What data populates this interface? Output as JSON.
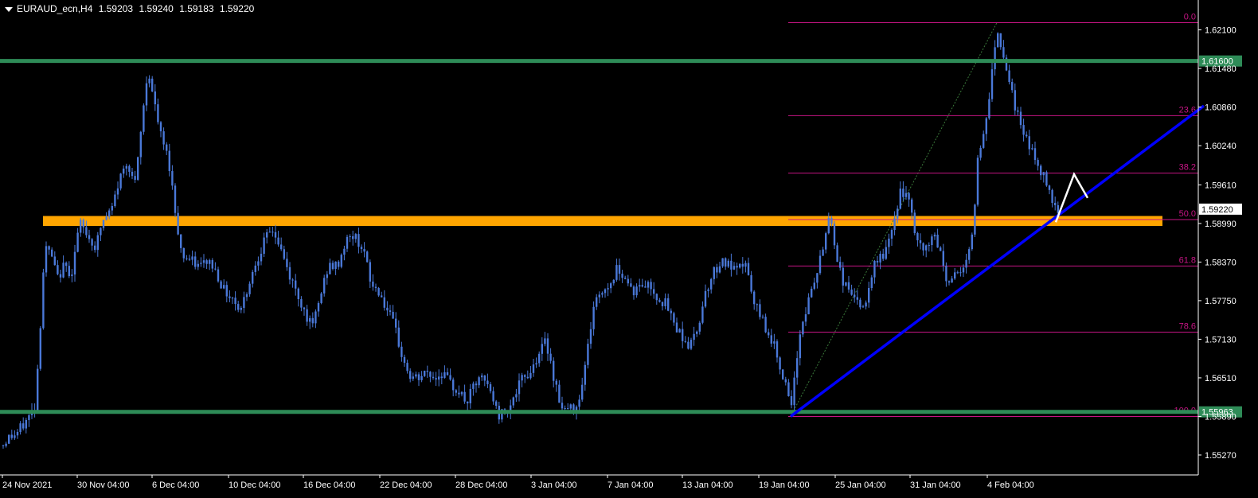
{
  "header": {
    "symbol": "EURAUD_ecn,H4",
    "open": "1.59203",
    "high": "1.59240",
    "low": "1.59183",
    "close": "1.59220"
  },
  "colors": {
    "background": "#000000",
    "candle": "#4a78d8",
    "support_line": "#2e8b57",
    "zone": "#ffa500",
    "trendline": "#0000ff",
    "fibo": "#c71585",
    "projection": "#ffffff",
    "axis_text": "#ffffff"
  },
  "chart_data": {
    "type": "candlestick",
    "symbol": "EURAUD_ecn",
    "timeframe": "H4",
    "ylim": [
      1.5495,
      1.6258
    ],
    "y_ticks": [
      "1.62100",
      "1.61480",
      "1.60860",
      "1.60240",
      "1.59610",
      "1.58990",
      "1.58370",
      "1.57750",
      "1.57130",
      "1.56510",
      "1.55890",
      "1.55270"
    ],
    "x_ticks": [
      "24 Nov 2021",
      "30 Nov 04:00",
      "6 Dec 04:00",
      "10 Dec 04:00",
      "16 Dec 04:00",
      "22 Dec 04:00",
      "28 Dec 04:00",
      "3 Jan 04:00",
      "7 Jan 04:00",
      "13 Jan 04:00",
      "19 Jan 04:00",
      "25 Jan 04:00",
      "31 Jan 04:00",
      "4 Feb 04:00"
    ],
    "price_path": [
      [
        0,
        1.5535
      ],
      [
        10,
        1.5555
      ],
      [
        20,
        1.556
      ],
      [
        32,
        1.558
      ],
      [
        44,
        1.5605
      ],
      [
        50,
        1.572
      ],
      [
        56,
        1.586
      ],
      [
        64,
        1.585
      ],
      [
        72,
        1.581
      ],
      [
        80,
        1.583
      ],
      [
        90,
        1.582
      ],
      [
        100,
        1.59
      ],
      [
        110,
        1.588
      ],
      [
        120,
        1.586
      ],
      [
        128,
        1.59
      ],
      [
        140,
        1.592
      ],
      [
        150,
        1.597
      ],
      [
        160,
        1.6
      ],
      [
        170,
        1.596
      ],
      [
        178,
        1.606
      ],
      [
        186,
        1.615
      ],
      [
        194,
        1.609
      ],
      [
        202,
        1.604
      ],
      [
        212,
        1.6
      ],
      [
        220,
        1.592
      ],
      [
        228,
        1.585
      ],
      [
        238,
        1.584
      ],
      [
        250,
        1.583
      ],
      [
        262,
        1.584
      ],
      [
        272,
        1.582
      ],
      [
        282,
        1.579
      ],
      [
        292,
        1.578
      ],
      [
        302,
        1.576
      ],
      [
        312,
        1.58
      ],
      [
        322,
        1.584
      ],
      [
        332,
        1.587
      ],
      [
        342,
        1.589
      ],
      [
        352,
        1.586
      ],
      [
        362,
        1.582
      ],
      [
        372,
        1.579
      ],
      [
        382,
        1.576
      ],
      [
        392,
        1.573
      ],
      [
        402,
        1.578
      ],
      [
        412,
        1.583
      ],
      [
        424,
        1.583
      ],
      [
        434,
        1.587
      ],
      [
        444,
        1.588
      ],
      [
        456,
        1.586
      ],
      [
        466,
        1.58
      ],
      [
        476,
        1.579
      ],
      [
        486,
        1.576
      ],
      [
        496,
        1.573
      ],
      [
        506,
        1.568
      ],
      [
        516,
        1.565
      ],
      [
        526,
        1.565
      ],
      [
        536,
        1.566
      ],
      [
        546,
        1.565
      ],
      [
        556,
        1.566
      ],
      [
        566,
        1.564
      ],
      [
        576,
        1.563
      ],
      [
        586,
        1.561
      ],
      [
        596,
        1.564
      ],
      [
        606,
        1.565
      ],
      [
        616,
        1.563
      ],
      [
        626,
        1.559
      ],
      [
        636,
        1.56
      ],
      [
        646,
        1.562
      ],
      [
        656,
        1.565
      ],
      [
        666,
        1.566
      ],
      [
        676,
        1.569
      ],
      [
        686,
        1.571
      ],
      [
        696,
        1.565
      ],
      [
        706,
        1.56
      ],
      [
        716,
        1.56
      ],
      [
        726,
        1.561
      ],
      [
        736,
        1.568
      ],
      [
        746,
        1.577
      ],
      [
        756,
        1.579
      ],
      [
        766,
        1.58
      ],
      [
        776,
        1.583
      ],
      [
        786,
        1.581
      ],
      [
        796,
        1.579
      ],
      [
        806,
        1.58
      ],
      [
        816,
        1.58
      ],
      [
        826,
        1.578
      ],
      [
        836,
        1.577
      ],
      [
        846,
        1.574
      ],
      [
        856,
        1.572
      ],
      [
        866,
        1.57
      ],
      [
        876,
        1.573
      ],
      [
        886,
        1.579
      ],
      [
        896,
        1.582
      ],
      [
        906,
        1.584
      ],
      [
        916,
        1.583
      ],
      [
        926,
        1.582
      ],
      [
        936,
        1.584
      ],
      [
        946,
        1.577
      ],
      [
        956,
        1.575
      ],
      [
        966,
        1.572
      ],
      [
        976,
        1.569
      ],
      [
        986,
        1.564
      ],
      [
        994,
        1.56
      ],
      [
        1004,
        1.572
      ],
      [
        1014,
        1.577
      ],
      [
        1024,
        1.581
      ],
      [
        1034,
        1.586
      ],
      [
        1042,
        1.592
      ],
      [
        1050,
        1.585
      ],
      [
        1060,
        1.58
      ],
      [
        1070,
        1.579
      ],
      [
        1080,
        1.576
      ],
      [
        1090,
        1.578
      ],
      [
        1100,
        1.584
      ],
      [
        1110,
        1.585
      ],
      [
        1120,
        1.588
      ],
      [
        1130,
        1.595
      ],
      [
        1140,
        1.594
      ],
      [
        1150,
        1.588
      ],
      [
        1160,
        1.585
      ],
      [
        1170,
        1.588
      ],
      [
        1180,
        1.586
      ],
      [
        1190,
        1.58
      ],
      [
        1200,
        1.582
      ],
      [
        1210,
        1.583
      ],
      [
        1220,
        1.586
      ],
      [
        1228,
        1.6
      ],
      [
        1236,
        1.605
      ],
      [
        1244,
        1.612
      ],
      [
        1252,
        1.6215
      ],
      [
        1260,
        1.617
      ],
      [
        1268,
        1.613
      ],
      [
        1276,
        1.608
      ],
      [
        1284,
        1.605
      ],
      [
        1292,
        1.603
      ],
      [
        1300,
        1.6
      ],
      [
        1308,
        1.598
      ],
      [
        1316,
        1.596
      ],
      [
        1324,
        1.593
      ],
      [
        1330,
        1.5922
      ]
    ],
    "horizontal_lines": [
      {
        "price": 1.616,
        "label": "1.61600"
      },
      {
        "price": 1.55963,
        "label": "1.55963"
      }
    ],
    "current_price": "1.59220",
    "zone": {
      "price_top": 1.5911,
      "price_bottom": 1.5895
    },
    "fibonacci": {
      "high": 1.62215,
      "low": 1.5589,
      "levels": [
        {
          "ratio": 0.0,
          "label": "0.0"
        },
        {
          "ratio": 0.236,
          "label": "23.6"
        },
        {
          "ratio": 0.382,
          "label": "38.2"
        },
        {
          "ratio": 0.5,
          "label": "50.0"
        },
        {
          "ratio": 0.618,
          "label": "61.8"
        },
        {
          "ratio": 0.786,
          "label": "78.6"
        },
        {
          "ratio": 1.0,
          "label": "100.0"
        }
      ]
    },
    "trendline": {
      "start": [
        993,
        1.5589
      ],
      "end": [
        1512,
        1.6088
      ]
    },
    "projection": [
      [
        1326,
        1.5901
      ],
      [
        1349,
        1.5978
      ],
      [
        1366,
        1.594
      ]
    ]
  }
}
